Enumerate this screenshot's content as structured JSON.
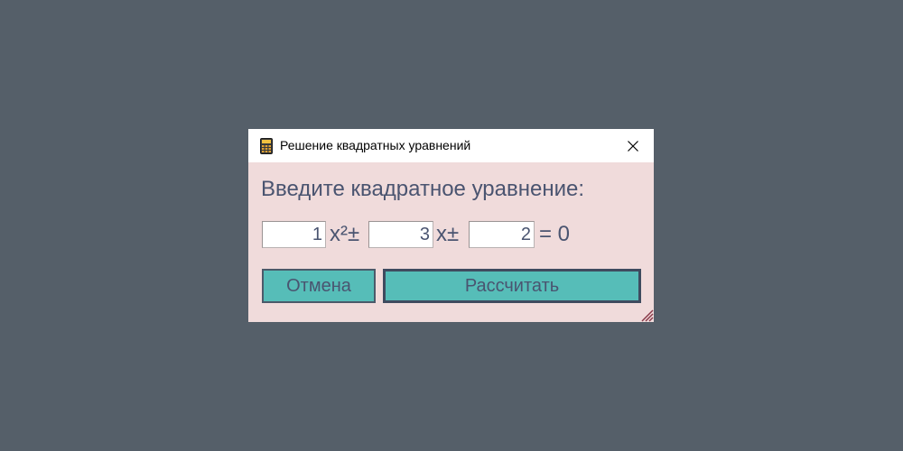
{
  "window": {
    "title": "Решение квадратных уравнений",
    "app_icon": "calculator-icon",
    "close_icon": "close-icon"
  },
  "form": {
    "prompt": "Введите квадратное уравнение:",
    "coefficient_a": "1",
    "coefficient_b": "3",
    "coefficient_c": "2",
    "op_x_squared": "x²±",
    "op_x": "x±",
    "op_equals": "= 0"
  },
  "buttons": {
    "cancel_label": "Отмена",
    "calculate_label": "Рассчитать"
  },
  "colors": {
    "desktop": "#555f69",
    "window_bg": "#f0dbdb",
    "button_bg": "#56bdb8",
    "text": "#4a5470",
    "grip": "#8a3a4a"
  }
}
